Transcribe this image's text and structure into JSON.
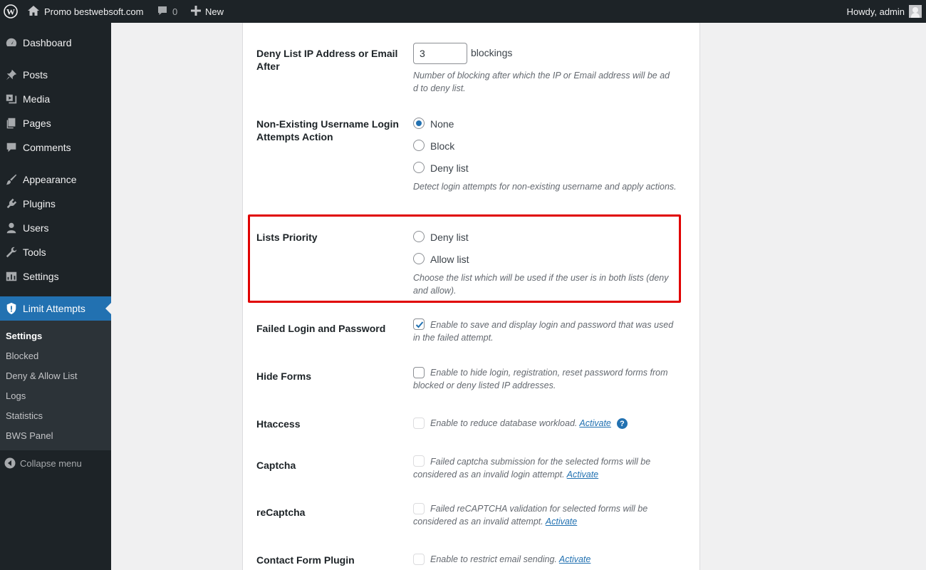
{
  "admin_bar": {
    "site_name": "Promo bestwebsoft.com",
    "comments_count": "0",
    "new_label": "New",
    "howdy": "Howdy, admin"
  },
  "sidebar": {
    "items": [
      {
        "label": "Dashboard",
        "icon": "dashboard-icon"
      },
      {
        "label": "Posts",
        "icon": "pin-icon"
      },
      {
        "label": "Media",
        "icon": "media-icon"
      },
      {
        "label": "Pages",
        "icon": "pages-icon"
      },
      {
        "label": "Comments",
        "icon": "comment-icon"
      },
      {
        "label": "Appearance",
        "icon": "brush-icon"
      },
      {
        "label": "Plugins",
        "icon": "plug-icon"
      },
      {
        "label": "Users",
        "icon": "user-icon"
      },
      {
        "label": "Tools",
        "icon": "wrench-icon"
      },
      {
        "label": "Settings",
        "icon": "settings-icon"
      },
      {
        "label": "Limit Attempts",
        "icon": "shield-icon"
      }
    ],
    "submenu": [
      "Settings",
      "Blocked",
      "Deny & Allow List",
      "Logs",
      "Statistics",
      "BWS Panel"
    ],
    "collapse_label": "Collapse menu"
  },
  "settings": {
    "deny_after": {
      "label": "Deny List IP Address or Email After",
      "value": "3",
      "suffix": "blockings",
      "description": "Number of blocking after which the IP or Email address will be ad d to deny list."
    },
    "non_existing": {
      "label": "Non-Existing Username Login Attempts Action",
      "options": [
        "None",
        "Block",
        "Deny list"
      ],
      "selected": "None",
      "description": "Detect login attempts for non-existing username and apply actions."
    },
    "lists_priority": {
      "label": "Lists Priority",
      "options": [
        "Deny list",
        "Allow list"
      ],
      "description": "Choose the list which will be used if the user is in both lists (deny and allow)."
    },
    "failed_login": {
      "label": "Failed Login and Password",
      "checked": true,
      "description": "Enable to save and display login and password that was used in the failed attempt."
    },
    "hide_forms": {
      "label": "Hide Forms",
      "checked": false,
      "description": "Enable to hide login, registration, reset password forms from blocked or deny listed IP addresses."
    },
    "htaccess": {
      "label": "Htaccess",
      "description": "Enable to reduce database workload.",
      "link": "Activate"
    },
    "captcha": {
      "label": "Captcha",
      "description": "Failed captcha submission for the selected forms will be considered as an invalid login attempt.",
      "link": "Activate"
    },
    "recaptcha": {
      "label": "reCaptcha",
      "description": "Failed reCAPTCHA validation for selected forms will be considered as an invalid attempt.",
      "link": "Activate"
    },
    "contact_form": {
      "label": "Contact Form Plugin",
      "description": "Enable to restrict email sending.",
      "link": "Activate"
    }
  },
  "colors": {
    "admin_bg": "#1d2327",
    "accent": "#2271b1",
    "highlight": "#e00000"
  }
}
